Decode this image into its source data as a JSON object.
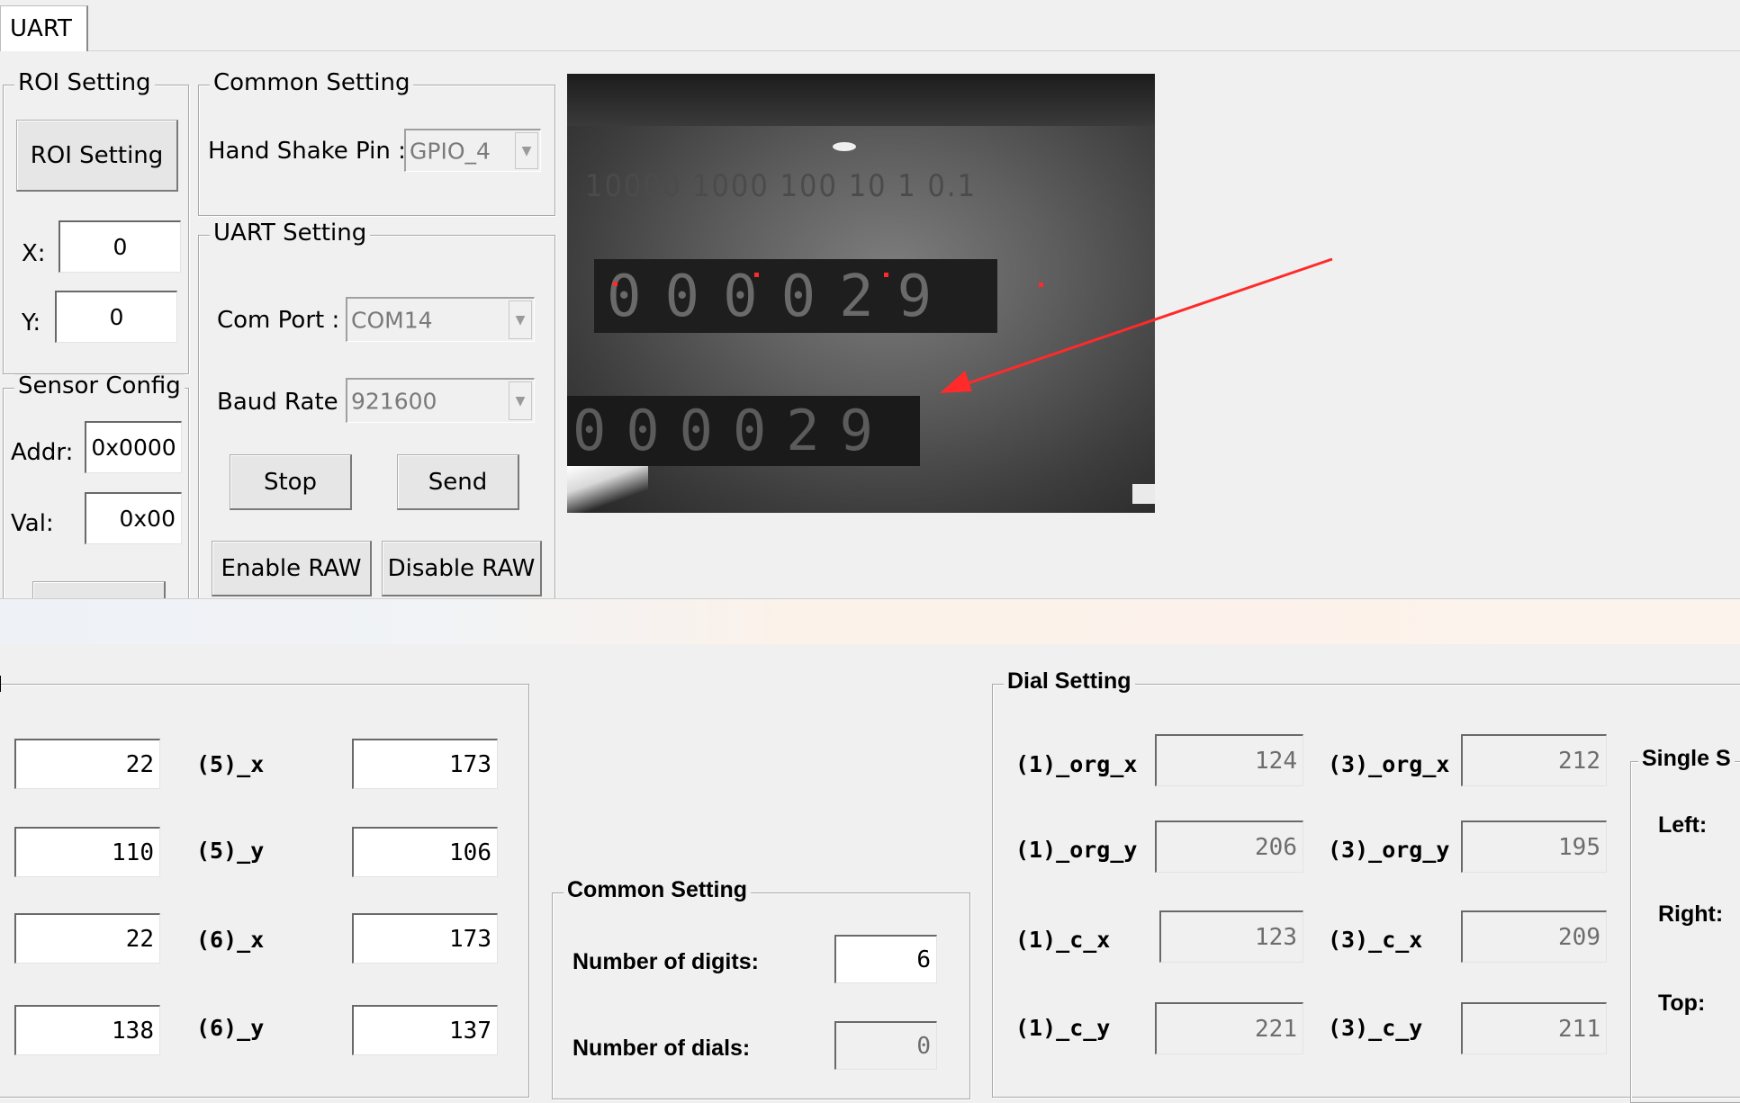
{
  "tab": {
    "label": "UART"
  },
  "roi": {
    "group_label": "ROI Setting",
    "button_label": "ROI Setting",
    "x_label": "X:",
    "x_value": "0",
    "y_label": "Y:",
    "y_value": "0"
  },
  "sensor": {
    "group_label": "Sensor Config",
    "addr_label": "Addr:",
    "addr_value": "0x0000",
    "val_label": "Val:",
    "val_value": "0x00"
  },
  "common": {
    "group_label": "Common Setting",
    "handshake_label": "Hand Shake Pin :",
    "handshake_value": "GPIO_4"
  },
  "uart": {
    "group_label": "UART Setting",
    "com_label": "Com Port :",
    "com_value": "COM14",
    "baud_label": "Baud Rate",
    "baud_value": "921600",
    "stop_label": "Stop",
    "send_label": "Send",
    "enable_raw_label": "Enable RAW",
    "disable_raw_label": "Disable RAW"
  },
  "preview": {
    "dial_text": "10000 1000 100 10 1 0.1"
  },
  "coords": {
    "rows": [
      {
        "left_value": "22",
        "label": "(5)_x",
        "right_value": "173"
      },
      {
        "left_value": "110",
        "label": "(5)_y",
        "right_value": "106"
      },
      {
        "left_value": "22",
        "label": "(6)_x",
        "right_value": "173"
      },
      {
        "left_value": "138",
        "label": "(6)_y",
        "right_value": "137"
      }
    ]
  },
  "common2": {
    "group_label": "Common Setting",
    "digits_label": "Number of digits:",
    "digits_value": "6",
    "dials_label": "Number of dials:",
    "dials_value": "0"
  },
  "dial": {
    "group_label": "Dial Setting",
    "rows": [
      {
        "l1": "(1)_org_x",
        "v1": "124",
        "l3": "(3)_org_x",
        "v3": "212"
      },
      {
        "l1": "(1)_org_y",
        "v1": "206",
        "l3": "(3)_org_y",
        "v3": "195"
      },
      {
        "l1": "(1)_c_x",
        "v1": "123",
        "l3": "(3)_c_x",
        "v3": "209"
      },
      {
        "l1": "(1)_c_y",
        "v1": "221",
        "l3": "(3)_c_y",
        "v3": "211"
      }
    ]
  },
  "single": {
    "group_label": "Single S",
    "left_label": "Left:",
    "right_label": "Right:",
    "top_label": "Top:"
  }
}
